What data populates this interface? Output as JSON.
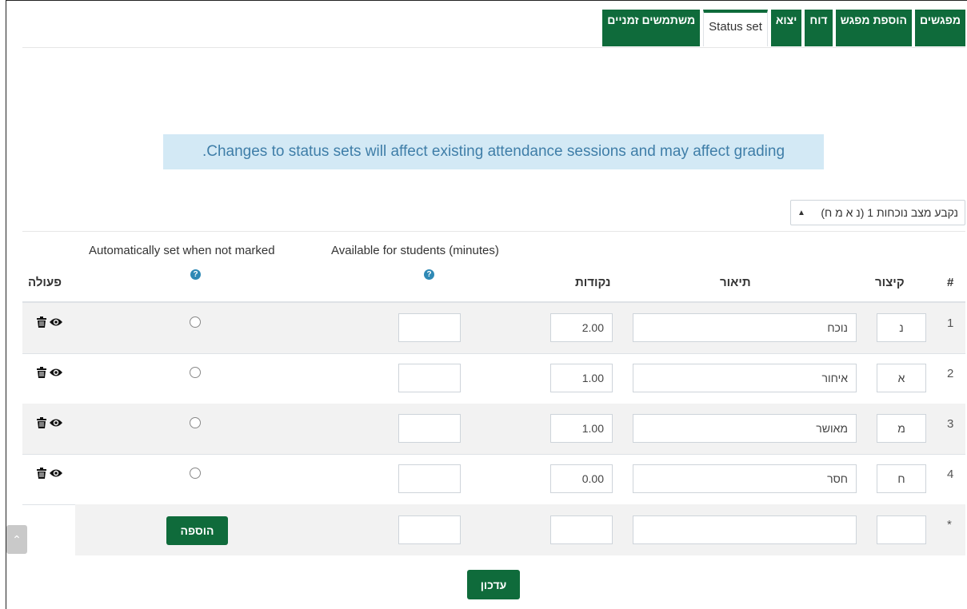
{
  "tabs": [
    {
      "label": "מפגשים"
    },
    {
      "label": "הוספת מפגש"
    },
    {
      "label": "דוח"
    },
    {
      "label": "יצוא"
    },
    {
      "label": "Status set",
      "active": true
    },
    {
      "label": "משתמשים זמניים"
    }
  ],
  "notice": ".Changes to status sets will affect existing attendance sessions and may affect grading",
  "status_set_select": {
    "value": "נקבע מצב נוכחות 1 (נ א מ ח)"
  },
  "table": {
    "headers": {
      "number": "#",
      "acronym": "קיצור",
      "description": "תיאור",
      "grade": "נקודות",
      "available": "Available for students (minutes)",
      "auto_set": "Automatically set when not marked",
      "action": "פעולה"
    },
    "rows": [
      {
        "num": "1",
        "acronym": "נ",
        "description": "נוכח",
        "grade": "2.00",
        "available": ""
      },
      {
        "num": "2",
        "acronym": "א",
        "description": "איחור",
        "grade": "1.00",
        "available": ""
      },
      {
        "num": "3",
        "acronym": "מ",
        "description": "מאושר",
        "grade": "1.00",
        "available": ""
      },
      {
        "num": "4",
        "acronym": "ח",
        "description": "חסר",
        "grade": "0.00",
        "available": ""
      }
    ],
    "new_row": {
      "num": "*",
      "add_label": "הוספה"
    }
  },
  "update_label": "עדכון",
  "colors": {
    "brand": "#0f6b3b",
    "info_bg": "#d3e9f5",
    "info_text": "#3f7ea8",
    "help": "#2f89b5"
  },
  "icons": {
    "action_delete": "trash-icon",
    "action_visibility": "eye-icon",
    "help": "question-circle-icon",
    "select": "sort-arrows-icon",
    "back_to_top": "chevron-up-icon"
  }
}
